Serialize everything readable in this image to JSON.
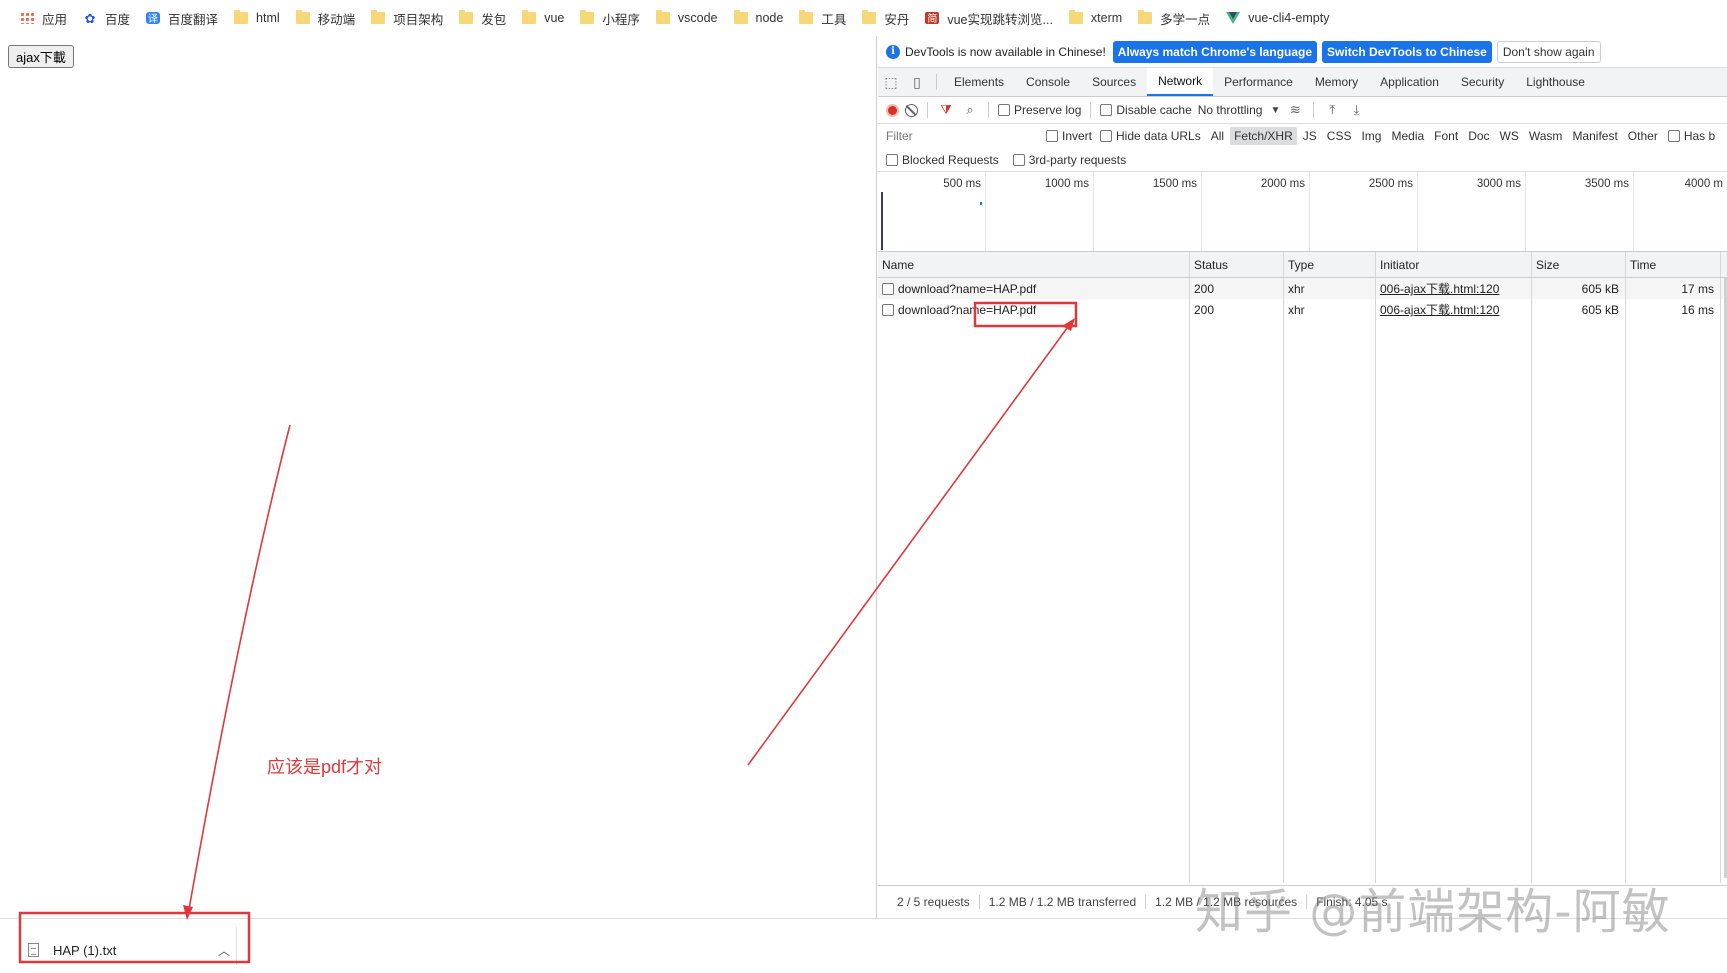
{
  "bookmarks": [
    {
      "label": "应用",
      "icon": "apps-grid-icon"
    },
    {
      "label": "百度",
      "icon": "baidu-paw-icon"
    },
    {
      "label": "百度翻译",
      "icon": "baidu-translate-icon"
    },
    {
      "label": "html",
      "icon": "folder-icon"
    },
    {
      "label": "移动端",
      "icon": "folder-icon"
    },
    {
      "label": "项目架构",
      "icon": "folder-icon"
    },
    {
      "label": "发包",
      "icon": "folder-icon"
    },
    {
      "label": "vue",
      "icon": "folder-icon"
    },
    {
      "label": "小程序",
      "icon": "folder-icon"
    },
    {
      "label": "vscode",
      "icon": "folder-icon"
    },
    {
      "label": "node",
      "icon": "folder-icon"
    },
    {
      "label": "工具",
      "icon": "folder-icon"
    },
    {
      "label": "安丹",
      "icon": "folder-icon"
    },
    {
      "label": "vue实现跳转浏览...",
      "icon": "jian-site-icon"
    },
    {
      "label": "xterm",
      "icon": "folder-icon"
    },
    {
      "label": "多学一点",
      "icon": "folder-icon"
    },
    {
      "label": "vue-cli4-empty",
      "icon": "vue-logo-icon"
    }
  ],
  "page": {
    "button_label": "ajax下載",
    "annotation": "应该是pdf才对"
  },
  "devtools": {
    "infobar": {
      "text": "DevTools is now available in Chinese!",
      "btn_match": "Always match Chrome's language",
      "btn_switch": "Switch DevTools to Chinese",
      "btn_dismiss": "Don't show again"
    },
    "tabs": [
      "Elements",
      "Console",
      "Sources",
      "Network",
      "Performance",
      "Memory",
      "Application",
      "Security",
      "Lighthouse"
    ],
    "active_tab": "Network",
    "toolbar": {
      "preserve_log": "Preserve log",
      "disable_cache": "Disable cache",
      "throttling": "No throttling"
    },
    "filter": {
      "placeholder": "Filter",
      "invert": "Invert",
      "hide_data_urls": "Hide data URLs",
      "types": [
        "All",
        "Fetch/XHR",
        "JS",
        "CSS",
        "Img",
        "Media",
        "Font",
        "Doc",
        "WS",
        "Wasm",
        "Manifest",
        "Other"
      ],
      "selected_type": "Fetch/XHR",
      "has_blocked": "Has b",
      "blocked_requests": "Blocked Requests",
      "third_party": "3rd-party requests"
    },
    "overview_ticks": [
      "500 ms",
      "1000 ms",
      "1500 ms",
      "2000 ms",
      "2500 ms",
      "3000 ms",
      "3500 ms",
      "4000 m"
    ],
    "columns": {
      "name": "Name",
      "status": "Status",
      "type": "Type",
      "initiator": "Initiator",
      "size": "Size",
      "time": "Time"
    },
    "rows": [
      {
        "name": "download?name=HAP.pdf",
        "status": "200",
        "type": "xhr",
        "initiator": "006-ajax下载.html:120",
        "size": "605 kB",
        "time": "17 ms"
      },
      {
        "name": "download?name=HAP.pdf",
        "status": "200",
        "type": "xhr",
        "initiator": "006-ajax下载.html:120",
        "size": "605 kB",
        "time": "16 ms"
      }
    ],
    "status": {
      "requests": "2 / 5 requests",
      "transferred": "1.2 MB / 1.2 MB transferred",
      "resources": "1.2 MB / 1.2 MB resources",
      "finish": "Finish: 4.05 s"
    }
  },
  "download": {
    "filename": "HAP (1).txt"
  },
  "watermark": "知乎 @前端架构-阿敏",
  "colors": {
    "annotation_red": "#e0383a",
    "devtools_blue": "#1a73e8",
    "folder_yellow": "#f7d878"
  }
}
